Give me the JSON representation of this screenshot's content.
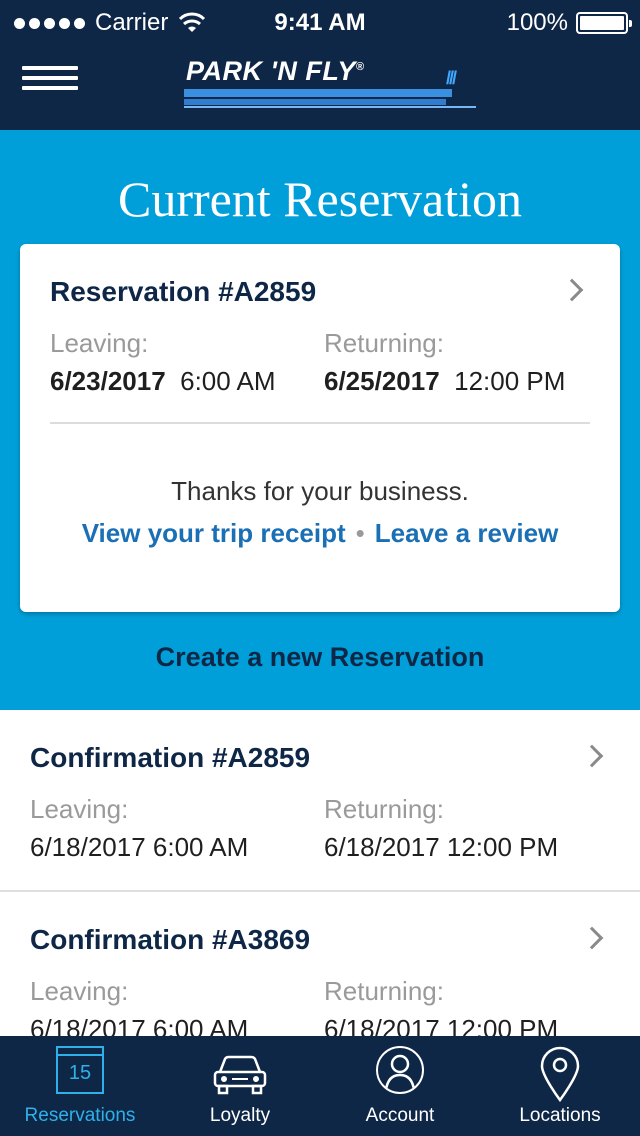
{
  "status_bar": {
    "carrier": "Carrier",
    "time": "9:41 AM",
    "battery": "100%"
  },
  "header": {
    "logo_text": "PARK 'N FLY",
    "logo_mark": "®"
  },
  "current": {
    "title": "Current Reservation",
    "reservation_title": "Reservation #A2859",
    "leaving_label": "Leaving:",
    "leaving_date": "6/23/2017",
    "leaving_time": "6:00 AM",
    "returning_label": "Returning:",
    "returning_date": "6/25/2017",
    "returning_time": "12:00 PM",
    "thanks": "Thanks for your business.",
    "receipt_link": "View your trip receipt",
    "separator": "•",
    "review_link": "Leave a review",
    "create_label": "Create a new Reservation"
  },
  "confirmations": [
    {
      "title": "Confirmation #A2859",
      "leaving_label": "Leaving:",
      "leaving": "6/18/2017  6:00 AM",
      "returning_label": "Returning:",
      "returning": "6/18/2017  12:00 PM"
    },
    {
      "title": "Confirmation #A3869",
      "leaving_label": "Leaving:",
      "leaving": "6/18/2017  6:00 AM",
      "returning_label": "Returning:",
      "returning": "6/18/2017  12:00 PM"
    }
  ],
  "tabs": {
    "reservations": "Reservations",
    "calendar_day": "15",
    "loyalty": "Loyalty",
    "account": "Account",
    "locations": "Locations"
  },
  "colors": {
    "navy": "#0f2747",
    "accent_blue": "#009fd9",
    "link_blue": "#1a6fb5",
    "active_tab": "#2fb0ea"
  },
  "icons": {
    "menu": "hamburger-icon",
    "wifi": "wifi-icon",
    "battery": "battery-icon",
    "chevron": "chevron-right-icon",
    "reservations": "calendar-icon",
    "loyalty": "car-icon",
    "account": "user-icon",
    "locations": "map-pin-icon"
  }
}
